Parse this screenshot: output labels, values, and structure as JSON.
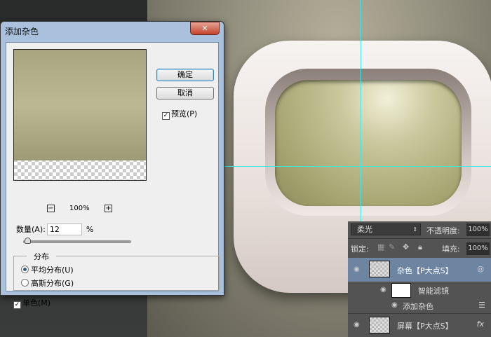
{
  "dialog": {
    "title": "添加杂色",
    "close_icon": "close-icon",
    "ok_label": "确定",
    "cancel_label": "取消",
    "preview_label": "预览(P)",
    "preview_checked": true,
    "zoom_level": "100%",
    "zoom_out": "−",
    "zoom_in": "+",
    "amount_label": "数量(A):",
    "amount_value": "12",
    "amount_unit": "%",
    "amount_slider_percent": 12,
    "distribution_label": "分布",
    "uniform_label": "平均分布(U)",
    "gaussian_label": "高斯分布(G)",
    "selected_distribution": "uniform",
    "mono_label": "单色(M)",
    "mono_checked": true
  },
  "layers": {
    "blend_mode": "柔光",
    "opacity_label": "不透明度:",
    "opacity_value": "100%",
    "lock_label": "锁定:",
    "fill_label": "填充:",
    "fill_value": "100%",
    "items": [
      {
        "name": "杂色【P大点S】",
        "selected": true
      },
      {
        "name": "智能滤镜"
      },
      {
        "name": "添加杂色"
      },
      {
        "name": "屏幕【P大点S】",
        "fx": "fx"
      }
    ]
  },
  "colors": {
    "guide": "#3ee8ea",
    "selected_layer": "#6e85a1"
  }
}
